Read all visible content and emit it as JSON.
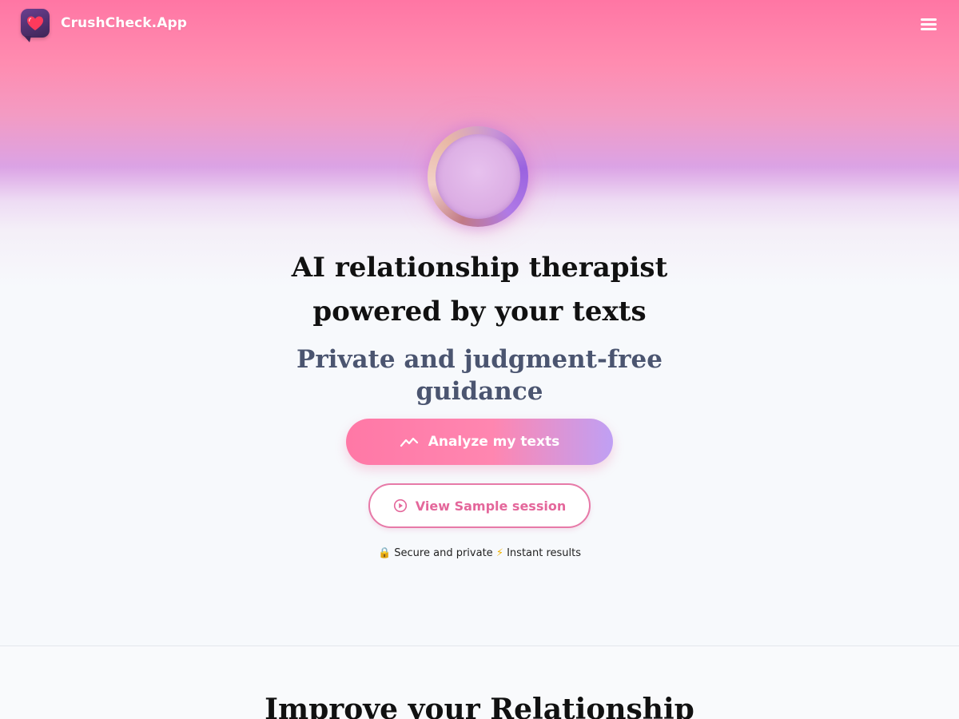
{
  "header": {
    "brand": "CrushCheck.App",
    "logo_icon": "heart-chat-icon",
    "menu_icon": "hamburger-menu-icon"
  },
  "hero": {
    "orb_icon": "ring-orb-icon",
    "headline_line1": "AI relationship therapist",
    "headline_line2": "powered by your texts",
    "subheadline_line1": "Private and judgment-free",
    "subheadline_line2": "guidance",
    "primary_button": {
      "label": "Analyze my texts",
      "icon": "trending-line-icon"
    },
    "secondary_button": {
      "label": "View Sample session",
      "icon": "play-circle-icon"
    },
    "trust": {
      "lock_glyph": "🔒",
      "secure_text": "Secure and private",
      "bolt_glyph": "⚡",
      "instant_text": "Instant results"
    }
  },
  "section": {
    "title": "Improve your Relationship"
  },
  "colors": {
    "brand_pink": "#ff76a4",
    "brand_purple": "#bfa0f4",
    "secondary_border": "#e77aa8",
    "subheadline": "#4b5570"
  }
}
